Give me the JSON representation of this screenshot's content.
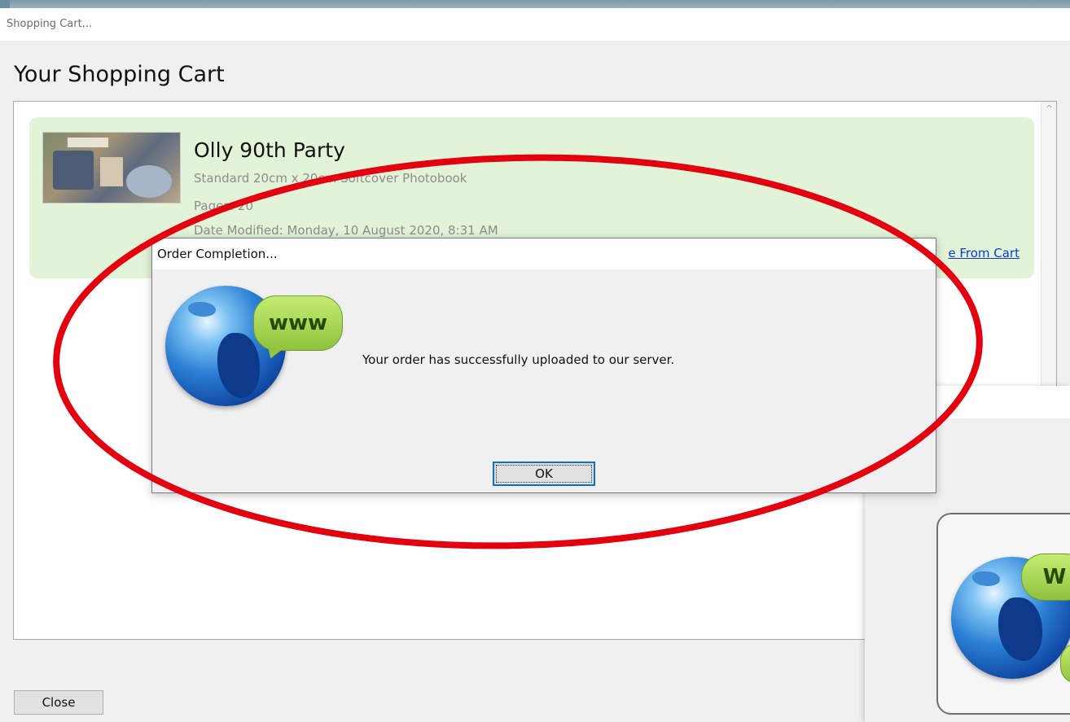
{
  "main_window": {
    "title": "Shopping Cart...",
    "heading": "Your Shopping Cart",
    "close_label": "Close"
  },
  "cart_item": {
    "title": "Olly 90th Party",
    "description": "Standard 20cm x 20cm Softcover Photobook",
    "pages": "Pages: 20",
    "date_modified": "Date Modified: Monday, 10 August 2020, 8:31 AM",
    "remove_label": "e From Cart"
  },
  "dialog": {
    "title": "Order Completion...",
    "message": "Your order has successfully uploaded to our server.",
    "ok_label": "OK",
    "icon_badge": "www"
  },
  "bg_window": {
    "icon_badge": "W"
  },
  "colors": {
    "annotation": "#e3000f",
    "cart_item_bg": "#e2f3d8",
    "link": "#0b3ad9",
    "focus": "#0a6fd6"
  }
}
